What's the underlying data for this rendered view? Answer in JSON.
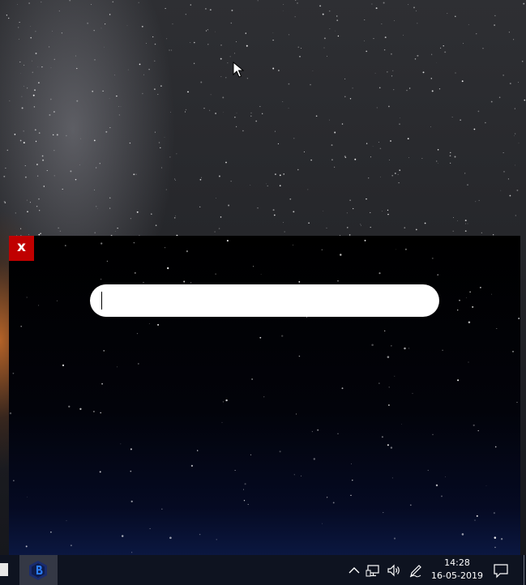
{
  "launcher": {
    "close_label": "x",
    "search": {
      "value": "",
      "placeholder": ""
    }
  },
  "taskbar": {
    "app_icon": "app-launcher-icon",
    "tray_icons": [
      "chevron-up-icon",
      "network-icon",
      "volume-icon",
      "pen-icon",
      "notifications-icon"
    ],
    "clock": {
      "time": "14:28",
      "date": "16-05-2019"
    }
  },
  "colors": {
    "close_button": "#c00000",
    "taskbar": "#0e1320",
    "taskbar_app_highlight": "#343845",
    "search_box": "#ffffff"
  }
}
